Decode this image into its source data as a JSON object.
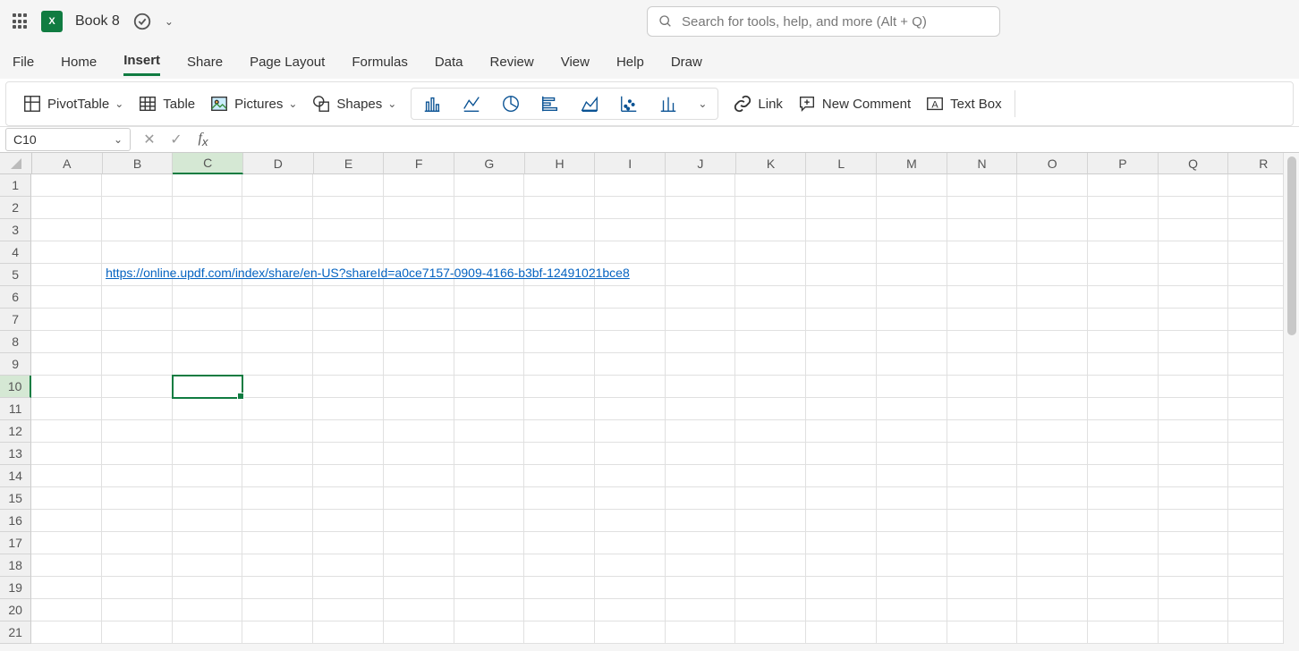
{
  "titlebar": {
    "doc_title": "Book 8",
    "excel_letters": "X"
  },
  "search": {
    "placeholder": "Search for tools, help, and more (Alt + Q)"
  },
  "tabs": [
    {
      "label": "File",
      "active": false
    },
    {
      "label": "Home",
      "active": false
    },
    {
      "label": "Insert",
      "active": true
    },
    {
      "label": "Share",
      "active": false
    },
    {
      "label": "Page Layout",
      "active": false
    },
    {
      "label": "Formulas",
      "active": false
    },
    {
      "label": "Data",
      "active": false
    },
    {
      "label": "Review",
      "active": false
    },
    {
      "label": "View",
      "active": false
    },
    {
      "label": "Help",
      "active": false
    },
    {
      "label": "Draw",
      "active": false
    }
  ],
  "ribbon": {
    "pivot": "PivotTable",
    "table": "Table",
    "pictures": "Pictures",
    "shapes": "Shapes",
    "link": "Link",
    "new_comment": "New Comment",
    "text_box": "Text Box"
  },
  "formula_bar": {
    "cell_ref": "C10",
    "formula": ""
  },
  "grid": {
    "columns": [
      "A",
      "B",
      "C",
      "D",
      "E",
      "F",
      "G",
      "H",
      "I",
      "J",
      "K",
      "L",
      "M",
      "N",
      "O",
      "P",
      "Q",
      "R"
    ],
    "rows": [
      1,
      2,
      3,
      4,
      5,
      6,
      7,
      8,
      9,
      10,
      11,
      12,
      13,
      14,
      15,
      16,
      17,
      18,
      19,
      20,
      21
    ],
    "active_col": "C",
    "active_row": 10,
    "link_cell": {
      "row": 5,
      "col": "B",
      "text": "https://online.updf.com/index/share/en-US?shareId=a0ce7157-0909-4166-b3bf-12491021bce8"
    }
  }
}
